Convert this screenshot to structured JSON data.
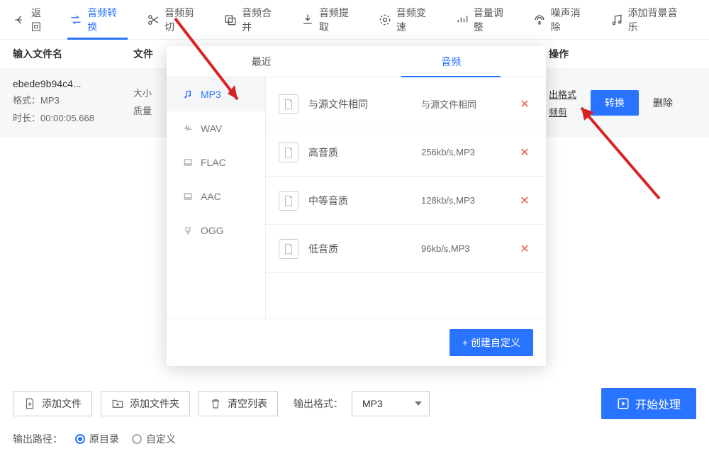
{
  "toolbar": {
    "back": "返回",
    "items": [
      {
        "label": "音频转换"
      },
      {
        "label": "音频剪切"
      },
      {
        "label": "音频合并"
      },
      {
        "label": "音频提取"
      },
      {
        "label": "音频变速"
      },
      {
        "label": "音量调整"
      },
      {
        "label": "噪声消除"
      },
      {
        "label": "添加背景音乐"
      }
    ]
  },
  "header": {
    "name": "输入文件名",
    "attr": "文件",
    "ops": "操作"
  },
  "file": {
    "name": "ebede9b94c4...",
    "format_label": "格式：",
    "format": "MP3",
    "duration_label": "时长：",
    "duration": "00:00:05.668",
    "size_label": "大小",
    "quality_label": "质量",
    "op_outfmt": "出格式",
    "op_clip": "频剪",
    "convert": "转换",
    "delete": "删除"
  },
  "popup": {
    "tab_recent": "最近",
    "tab_audio": "音频",
    "formats": [
      {
        "label": "MP3"
      },
      {
        "label": "WAV"
      },
      {
        "label": "FLAC"
      },
      {
        "label": "AAC"
      },
      {
        "label": "OGG"
      }
    ],
    "qualities": [
      {
        "name": "与源文件相同",
        "value": "与源文件相同"
      },
      {
        "name": "高音质",
        "value": "256kb/s,MP3"
      },
      {
        "name": "中等音质",
        "value": "128kb/s,MP3"
      },
      {
        "name": "低音质",
        "value": "96kb/s,MP3"
      }
    ],
    "create_custom": "+  创建自定义"
  },
  "bottom": {
    "add_file": "添加文件",
    "add_folder": "添加文件夹",
    "clear": "清空列表",
    "out_fmt_label": "输出格式：",
    "out_fmt_value": "MP3",
    "start": "开始处理",
    "out_path_label": "输出路径：",
    "radio_origin": "原目录",
    "radio_custom": "自定义"
  }
}
